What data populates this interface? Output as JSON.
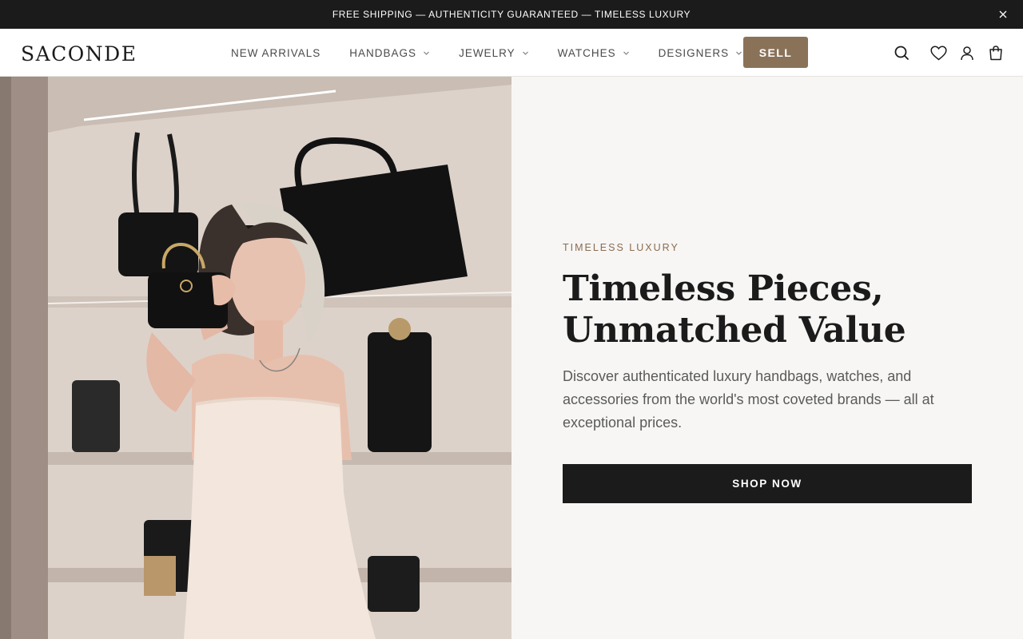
{
  "announcement": {
    "text": "FREE SHIPPING — AUTHENTICITY GUARANTEED — TIMELESS LUXURY",
    "close_icon": "close-icon"
  },
  "header": {
    "logo": "SACONDE",
    "nav": [
      {
        "label": "NEW ARRIVALS",
        "has_dropdown": false
      },
      {
        "label": "HANDBAGS",
        "has_dropdown": true
      },
      {
        "label": "JEWELRY",
        "has_dropdown": true
      },
      {
        "label": "WATCHES",
        "has_dropdown": true
      },
      {
        "label": "DESIGNERS",
        "has_dropdown": true
      }
    ],
    "sell_label": "SELL",
    "icons": [
      "search-icon",
      "heart-icon",
      "account-icon",
      "cart-icon"
    ]
  },
  "hero": {
    "eyebrow": "TIMELESS LUXURY",
    "headline_line1": "Timeless Pieces,",
    "headline_line2": "Unmatched Value",
    "subcopy": "Discover authenticated luxury handbags, watches, and accessories from the world's most coveted brands — all at exceptional prices.",
    "cta_label": "SHOP NOW"
  },
  "colors": {
    "announcement_bg": "#1b1b1b",
    "accent": "#8a7259",
    "eyebrow": "#8a6c50",
    "cta_bg": "#1b1b1b",
    "page_bg": "#f7f6f4"
  }
}
